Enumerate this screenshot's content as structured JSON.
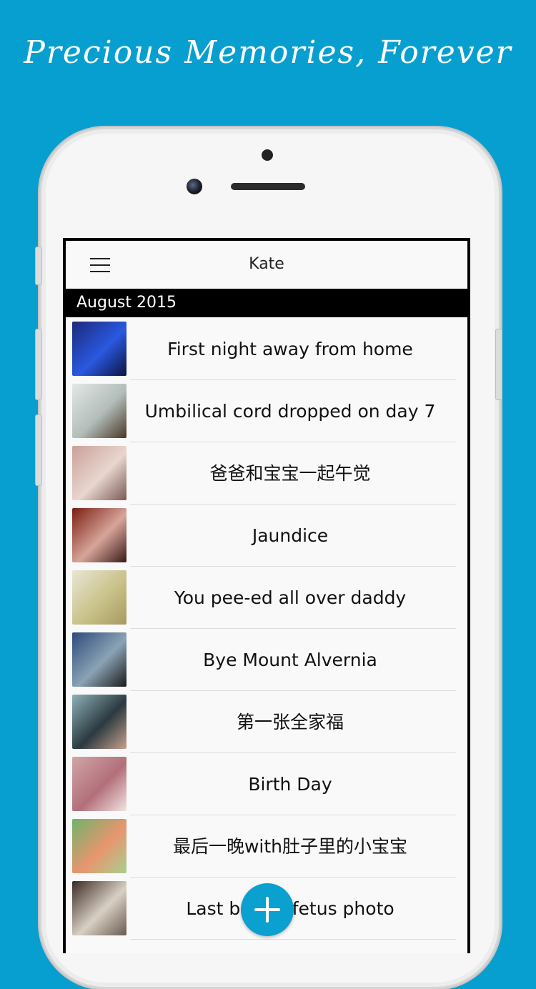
{
  "tagline": "Precious Memories, Forever",
  "app": {
    "title": "Kate",
    "section": "August 2015"
  },
  "entries": [
    {
      "title": "First night away from home",
      "thumb": [
        "#1b2a7a",
        "#2a58e0",
        "#0c1440"
      ]
    },
    {
      "title": "Umbilical cord dropped on day 7",
      "thumb": [
        "#e3e8e6",
        "#b2bdb9",
        "#4a3626"
      ]
    },
    {
      "title": "爸爸和宝宝一起午觉",
      "thumb": [
        "#caa09a",
        "#e8d6cf",
        "#7a5a55"
      ]
    },
    {
      "title": "Jaundice",
      "thumb": [
        "#7b1d12",
        "#d7a59a",
        "#3a1a16"
      ]
    },
    {
      "title": "You pee-ed all over daddy",
      "thumb": [
        "#e9e6d5",
        "#c9c28a",
        "#a79a5f"
      ]
    },
    {
      "title": "Bye Mount Alvernia",
      "thumb": [
        "#2d4a7a",
        "#8aa3b5",
        "#1b1b1b"
      ]
    },
    {
      "title": "第一张全家福",
      "thumb": [
        "#8fb0b8",
        "#2b3a40",
        "#c7a08d"
      ]
    },
    {
      "title": "Birth Day",
      "thumb": [
        "#d0a6a6",
        "#b26f7a",
        "#f2e4e2"
      ]
    },
    {
      "title": "最后一晚with肚子里的小宝宝",
      "thumb": [
        "#6fb36a",
        "#e8956e",
        "#a9cf8f"
      ]
    },
    {
      "title": "Last before fetus photo",
      "thumb": [
        "#3b2a24",
        "#d9d0c4",
        "#6a5a50"
      ]
    }
  ],
  "add_button_label": "+"
}
